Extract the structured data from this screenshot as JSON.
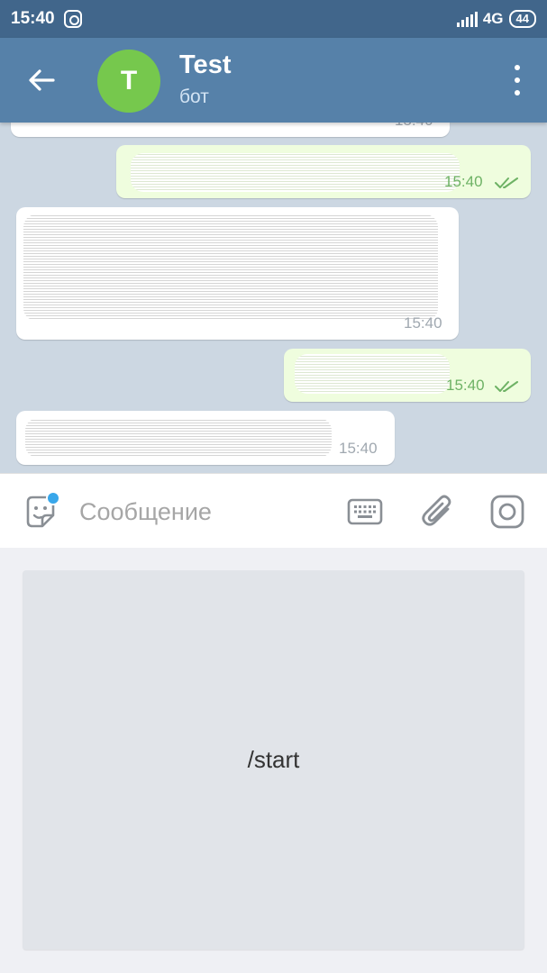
{
  "status_bar": {
    "time": "15:40",
    "network": "4G",
    "battery": "44"
  },
  "header": {
    "avatar_letter": "T",
    "title": "Test",
    "subtitle": "бот",
    "avatar_color": "#76c84d",
    "bar_color": "#5681a9"
  },
  "messages": [
    {
      "direction": "in",
      "time": "15:40",
      "read": false
    },
    {
      "direction": "out",
      "time": "15:40",
      "read": true
    },
    {
      "direction": "in",
      "time": "15:40",
      "read": false
    },
    {
      "direction": "out",
      "time": "15:40",
      "read": true
    },
    {
      "direction": "in",
      "time": "15:40",
      "read": false
    }
  ],
  "composer": {
    "placeholder": "Сообщение"
  },
  "bot_keyboard": {
    "buttons": [
      "/start"
    ]
  },
  "colors": {
    "incoming_bubble": "#ffffff",
    "outgoing_bubble": "#effdde",
    "chat_background": "#ccd7e2",
    "check_color": "#6eb265"
  }
}
